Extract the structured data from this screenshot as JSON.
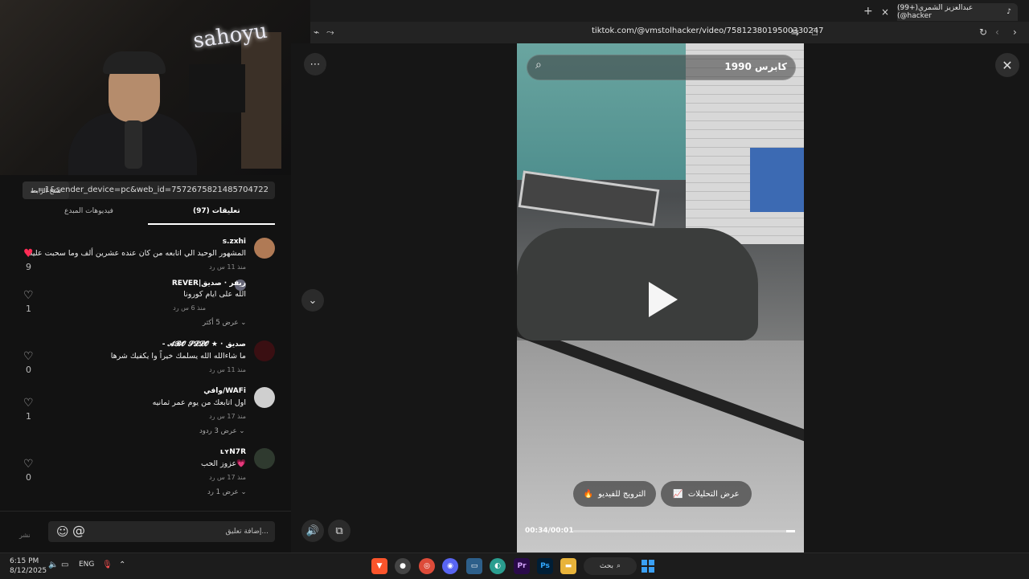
{
  "browser": {
    "tab_title": "(99+)عبدالعزيز الشمري (@hacker",
    "tab_close": "×",
    "tab_new": "+",
    "url": "tiktok.com/@vmstolhacker/video/7581238019500330247"
  },
  "stream": {
    "neon_text": "sahoyu"
  },
  "comments_panel": {
    "copy_link_label": "نسخ الرابط",
    "share_url": "...=1&sender_device=pc&web_id=7572675821485704722",
    "tabs": [
      {
        "label": "(97) تعليقات",
        "active": true
      },
      {
        "label": "فيديوهات المبدع",
        "active": false
      }
    ],
    "comments": [
      {
        "user": "s.zxhi",
        "text": "المشهور الوحيد الي اتابعه من كان عنده عشرين ألف وما سحبت عليه",
        "meta": "منذ 11 س    رد",
        "likes": "9",
        "liked": true
      },
      {
        "user": "REVER|ريفر · صديق",
        "text": "الله على ايام كورونا",
        "meta": "منذ 6 س    رد",
        "likes": "1",
        "liked": false,
        "more": "عرض 5 أكثر"
      },
      {
        "user": "- 𝓐𝓑𝓞 𝓢𝓛𝓛𝓞 ★ · صديق",
        "text": "ما شاءالله الله يسلمك خيراً وا يكفيك شرها",
        "meta": "منذ 11 س    رد",
        "likes": "0",
        "liked": false
      },
      {
        "user": "وافي/WAFi",
        "text": "اول اتابعك من يوم عمر ثمانيه",
        "meta": "منذ 17 س    رد",
        "likes": "1",
        "liked": false,
        "more": "عرض 3 ردود"
      },
      {
        "user": "ʟʏN7R",
        "text": "عزوز الحب💗",
        "meta": "منذ 17 س    رد",
        "likes": "0",
        "liked": false,
        "more": "عرض 1 رد"
      }
    ],
    "input_placeholder": "إضافة تعليق...",
    "post_label": "نشر"
  },
  "video": {
    "search_text": "كابرس 1990",
    "promote_label": "الترويج للفيديو",
    "analytics_label": "عرض التحليلات",
    "time": "00:34/00:01",
    "progress": 0.04
  },
  "taskbar": {
    "time": "6:15 PM",
    "date": "8/12/2025",
    "lang": "ENG",
    "search_label": "بحث",
    "apps": [
      "Pr",
      "Ps"
    ]
  },
  "colors": {
    "like_active": "#fe2c55",
    "accent_blue": "#3aa0f5"
  }
}
